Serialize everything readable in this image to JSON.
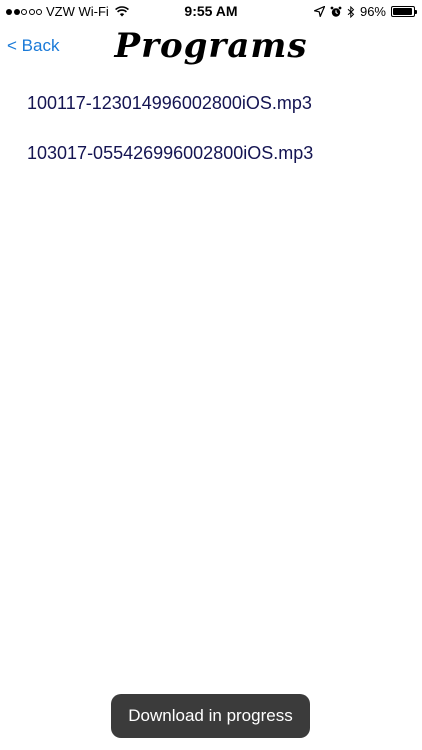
{
  "status_bar": {
    "carrier": "VZW Wi-Fi",
    "time": "9:55 AM",
    "battery_percent": "96%",
    "battery_level": 0.96,
    "signal_bars_filled": 2,
    "signal_bars_total": 5
  },
  "nav": {
    "back_label": "< Back",
    "title": "Programs"
  },
  "files": [
    {
      "name": "100117-123014996002800iOS.mp3"
    },
    {
      "name": "103017-055426996002800iOS.mp3"
    }
  ],
  "toast": {
    "message": "Download in progress"
  },
  "colors": {
    "link_blue": "#1a7ad8",
    "file_text": "#141452",
    "toast_bg": "#3b3b3b"
  }
}
